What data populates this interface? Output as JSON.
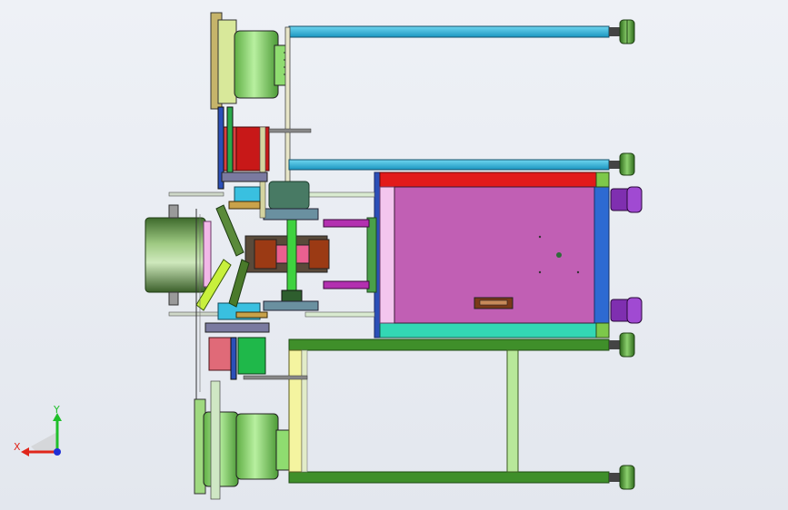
{
  "viewport": {
    "background": "#e9ecf2"
  },
  "triad": {
    "x_label": "X",
    "y_label": "Y",
    "x_color": "#e0261b",
    "y_color": "#1fbf2a",
    "z_color": "#1f2fd6"
  },
  "icons": {
    "triad": "axis-triad-icon"
  }
}
